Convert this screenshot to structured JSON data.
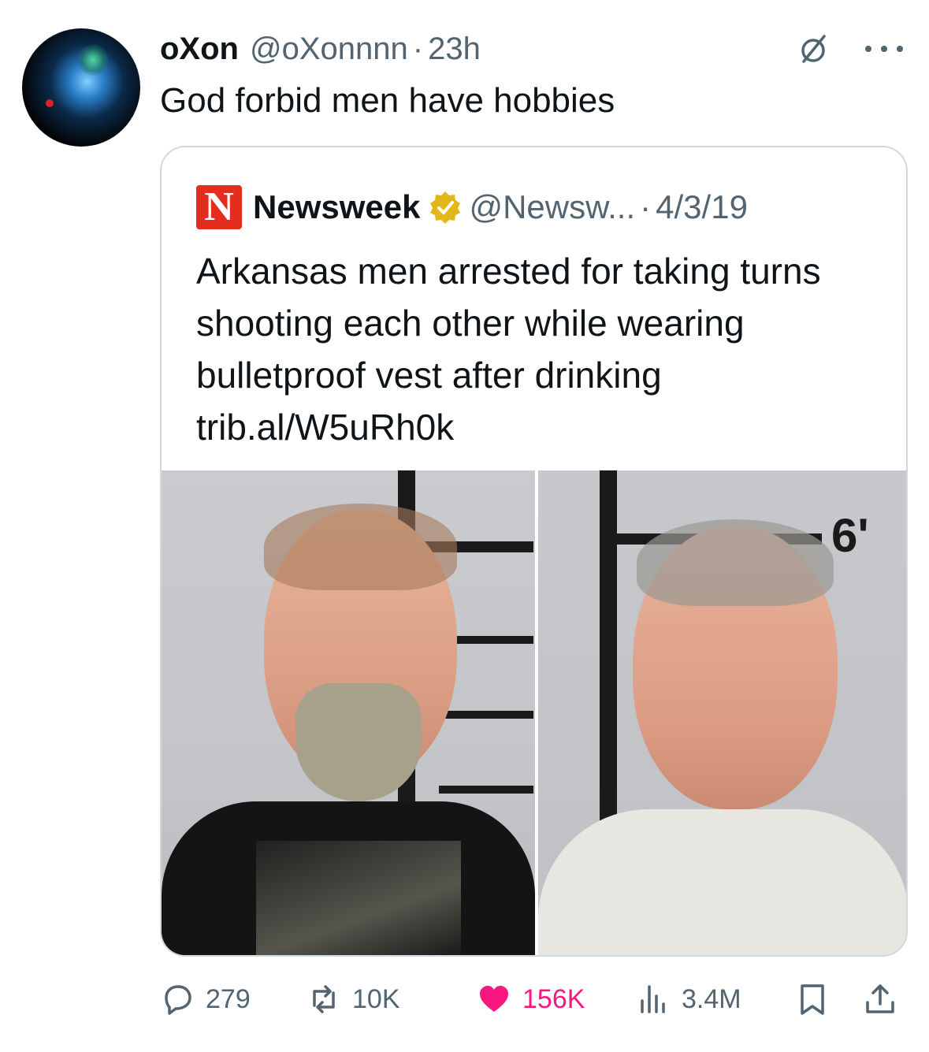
{
  "tweet": {
    "author": {
      "display_name": "oXon",
      "handle": "@oXonnnn",
      "time": "23h"
    },
    "text": "God forbid men have hobbies",
    "quote": {
      "source_logo_letter": "N",
      "display_name": "Newsweek",
      "handle": "@Newsw...",
      "date": "4/3/19",
      "text": "Arkansas men arrested for taking turns shooting each other while wearing bulletproof vest after drinking trib.al/W5uRh0k",
      "media": {
        "height_label": "6'"
      }
    },
    "actions": {
      "replies": "279",
      "reposts": "10K",
      "likes": "156K",
      "views": "3.4M"
    }
  },
  "colors": {
    "text": "#0f1419",
    "secondary": "#536471",
    "like": "#f91880",
    "verified": "#e2b719",
    "newsweek_red": "#e52d1f",
    "border": "#cfd9de"
  },
  "icons": [
    "grok-icon",
    "more-icon",
    "verified-badge-icon",
    "reply-icon",
    "repost-icon",
    "like-icon",
    "views-icon",
    "bookmark-icon",
    "share-icon"
  ]
}
